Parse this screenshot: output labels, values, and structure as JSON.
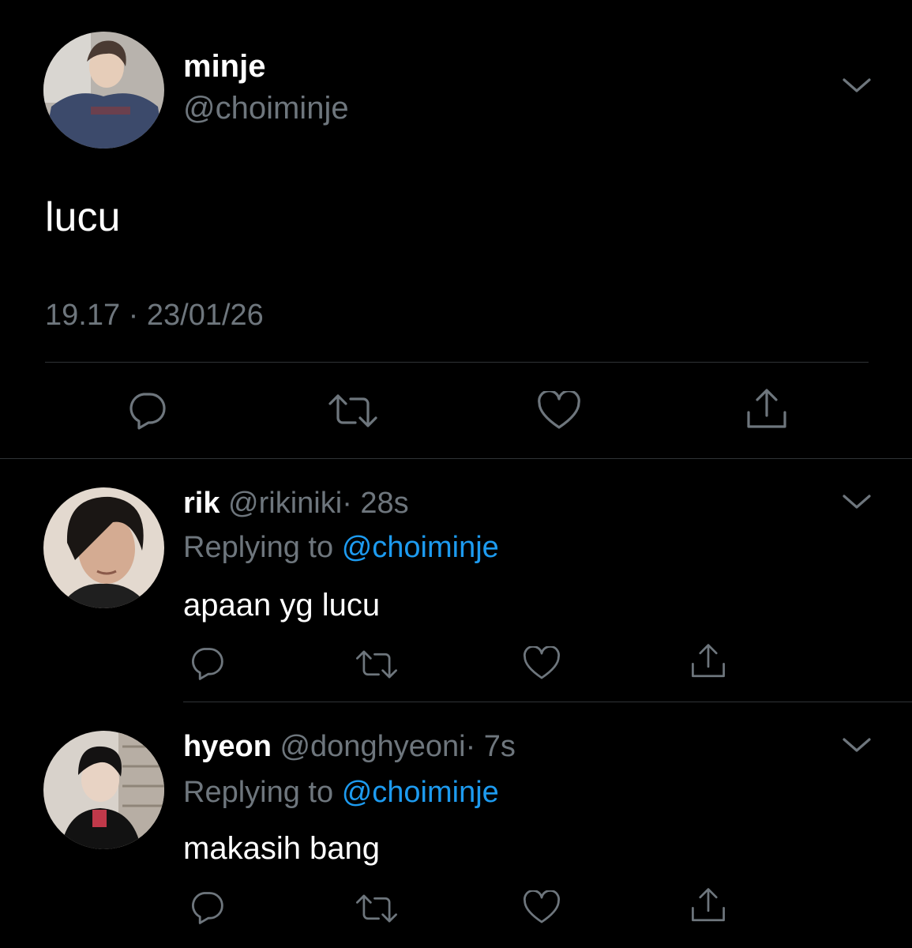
{
  "main_tweet": {
    "display_name": "minje",
    "handle": "@choiminje",
    "text": "lucu",
    "timestamp": "19.17 · 23/01/26",
    "avatar_icon": "user-avatar-photo"
  },
  "replies": [
    {
      "display_name": "rik",
      "handle": "@rikiniki",
      "time": "· 28s",
      "replying_label": "Replying to",
      "replying_handle": "@choiminje",
      "text": "apaan yg lucu"
    },
    {
      "display_name": "hyeon",
      "handle": "@donghyeoni",
      "time": "· 7s",
      "replying_label": "Replying to",
      "replying_handle": "@choiminje",
      "text": "makasih bang"
    }
  ],
  "icons": [
    "chevron-down-icon",
    "reply-icon",
    "retweet-icon",
    "like-icon",
    "share-icon"
  ],
  "colors": {
    "background": "#000000",
    "text": "#ffffff",
    "muted": "#6e767d",
    "link": "#1d9bf0",
    "divider": "#2f3336"
  }
}
